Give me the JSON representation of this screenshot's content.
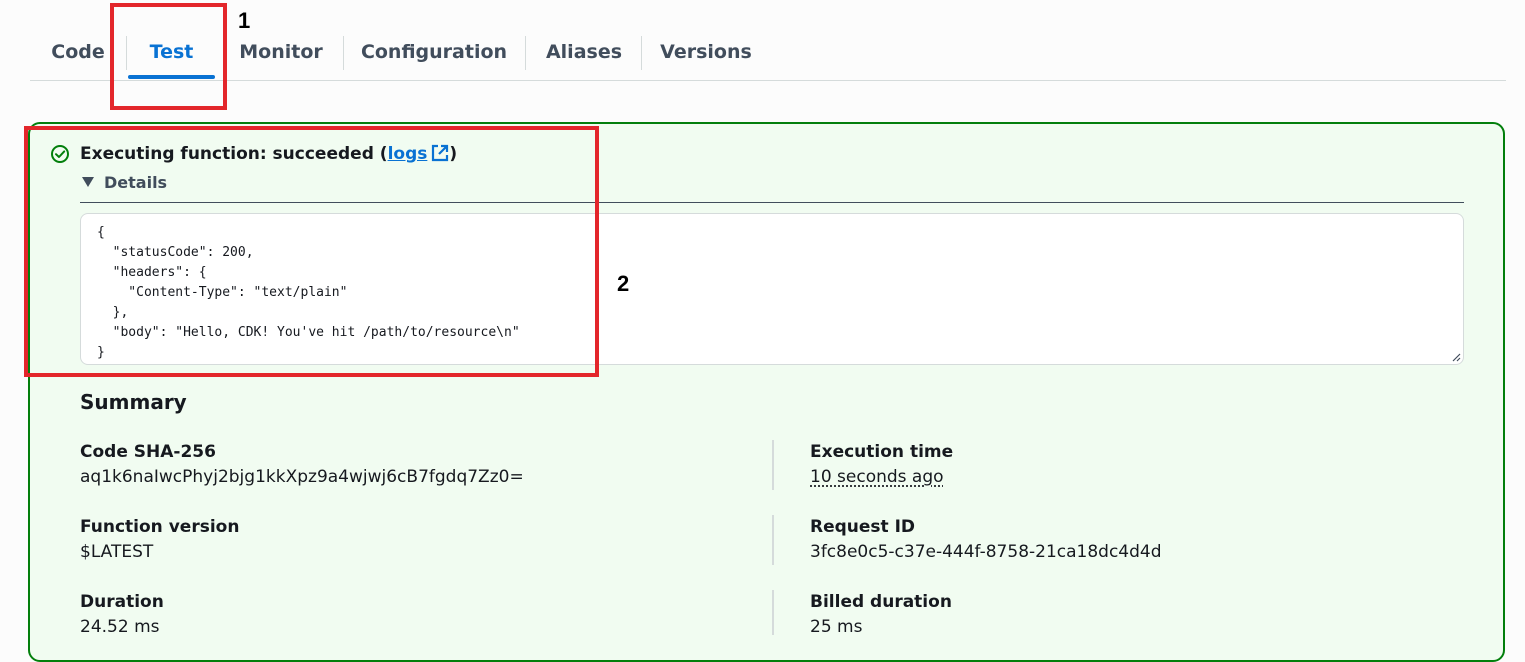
{
  "tabs": [
    {
      "label": "Code"
    },
    {
      "label": "Test"
    },
    {
      "label": "Monitor"
    },
    {
      "label": "Configuration"
    },
    {
      "label": "Aliases"
    },
    {
      "label": "Versions"
    }
  ],
  "active_tab": "Test",
  "annotations": {
    "one": "1",
    "two": "2"
  },
  "result": {
    "status_prefix": "Executing function: succeeded (",
    "logs_link": "logs",
    "status_suffix": ")",
    "details_label": "Details",
    "output_json": "{\n  \"statusCode\": 200,\n  \"headers\": {\n    \"Content-Type\": \"text/plain\"\n  },\n  \"body\": \"Hello, CDK! You've hit /path/to/resource\\n\"\n}"
  },
  "summary": {
    "title": "Summary",
    "code_sha_label": "Code SHA-256",
    "code_sha_value": "aq1k6naIwcPhyj2bjg1kkXpz9a4wjwj6cB7fgdq7Zz0=",
    "execution_time_label": "Execution time",
    "execution_time_value": "10 seconds ago",
    "function_version_label": "Function version",
    "function_version_value": "$LATEST",
    "request_id_label": "Request ID",
    "request_id_value": "3fc8e0c5-c37e-444f-8758-21ca18dc4d4d",
    "duration_label": "Duration",
    "duration_value": "24.52 ms",
    "billed_duration_label": "Billed duration",
    "billed_duration_value": "25 ms"
  },
  "colors": {
    "accent": "#0972d3",
    "success": "#037f0c",
    "success_bg": "#f1fcf1",
    "annotation": "#e3262b"
  },
  "icons": {
    "status": "success-check-icon",
    "external": "external-link-icon",
    "expand": "caret-down-icon"
  }
}
